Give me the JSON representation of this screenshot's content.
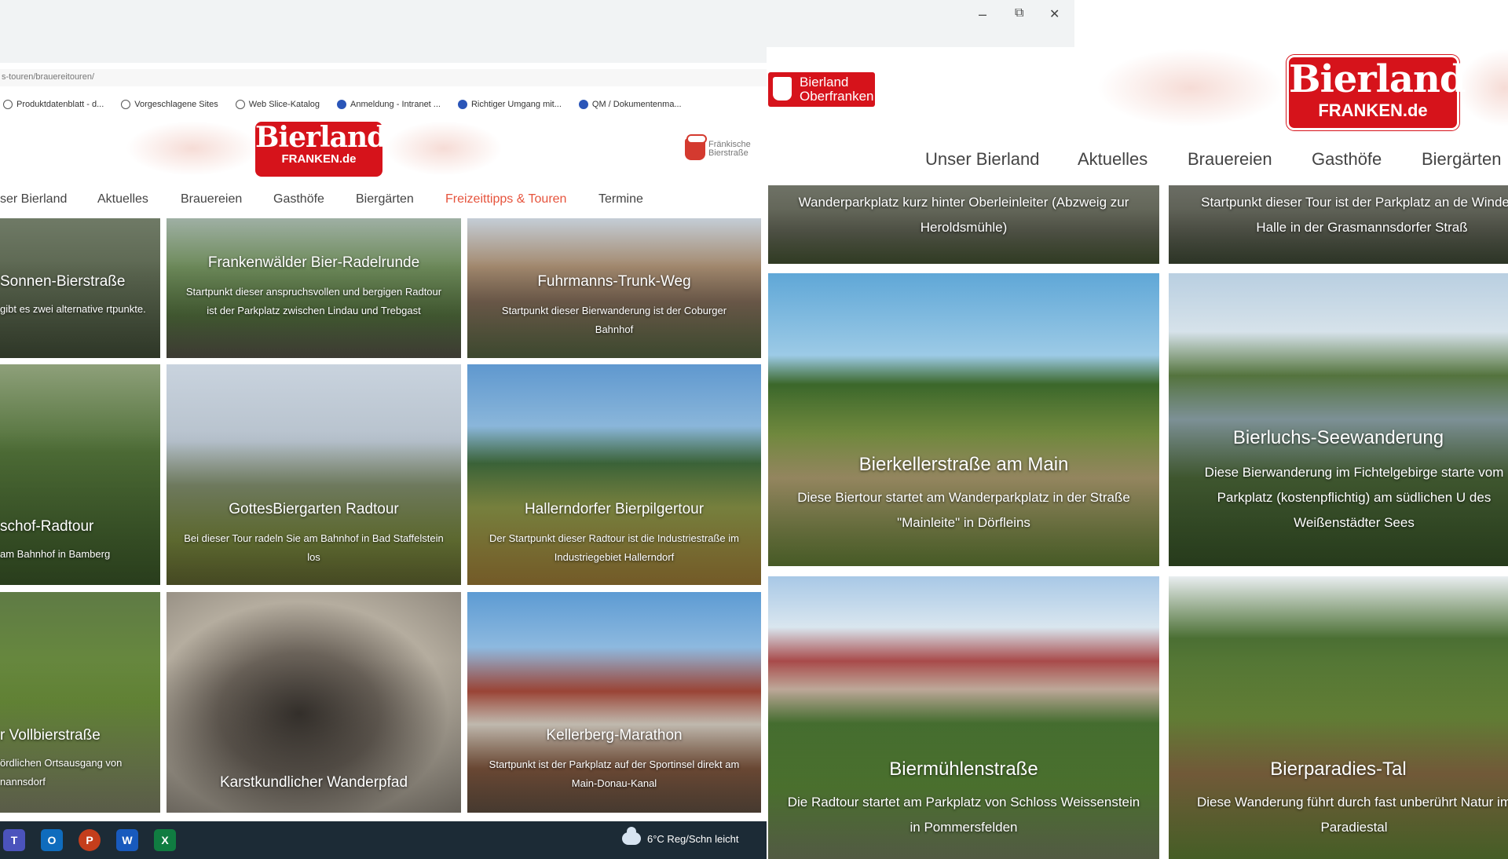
{
  "left_window": {
    "address_bar": {
      "url": "s-touren/brauereitouren/"
    },
    "bookmarks": [
      {
        "label": "Produktdatenblatt - d...",
        "icon": "globe-icon"
      },
      {
        "label": "Vorgeschlagene Sites",
        "icon": "globe-icon"
      },
      {
        "label": "Web Slice-Katalog",
        "icon": "globe-icon"
      },
      {
        "label": "Anmeldung - Intranet ...",
        "icon": "browser-icon"
      },
      {
        "label": "Richtiger Umgang mit...",
        "icon": "browser-icon"
      },
      {
        "label": "QM / Dokumentenma...",
        "icon": "browser-icon"
      }
    ],
    "logo": {
      "line1": "Bierland",
      "line2": "FRANKEN.de"
    },
    "franken_badge": {
      "line1": "Fränkische",
      "line2": "Bierstraße"
    },
    "nav": [
      {
        "label": "ser Bierland"
      },
      {
        "label": "Aktuelles"
      },
      {
        "label": "Brauereien"
      },
      {
        "label": "Gasthöfe"
      },
      {
        "label": "Biergärten"
      },
      {
        "label": "Freizeittipps & Touren"
      },
      {
        "label": "Termine"
      }
    ],
    "tiles": [
      {
        "title": "Sonnen-Bierstraße",
        "desc": "gibt es zwei alternative rtpunkte."
      },
      {
        "title": "Frankenwälder Bier-Radelrunde",
        "desc": "Startpunkt dieser anspruchsvollen und bergigen Radtour ist der Parkplatz zwischen Lindau und Trebgast"
      },
      {
        "title": "Fuhrmanns-Trunk-Weg",
        "desc": "Startpunkt dieser Bierwanderung ist der Coburger Bahnhof"
      },
      {
        "title": "schof-Radtour",
        "desc": "am Bahnhof in Bamberg"
      },
      {
        "title": "GottesBiergarten Radtour",
        "desc": "Bei dieser Tour radeln Sie am Bahnhof in Bad Staffelstein los"
      },
      {
        "title": "Hallerndorfer Bierpilgertour",
        "desc": "Der Startpunkt dieser Radtour ist die Industriestraße im Industriegebiet Hallerndorf"
      },
      {
        "title": "r Vollbierstraße",
        "desc": "ördlichen Ortsausgang von nannsdorf"
      },
      {
        "title": "Karstkundlicher Wanderpfad",
        "desc": ""
      },
      {
        "title": "Kellerberg-Marathon",
        "desc": "Startpunkt ist der Parkplatz auf der Sportinsel direkt am Main-Donau-Kanal"
      }
    ],
    "taskbar": {
      "apps": [
        "Teams",
        "Outlook",
        "PowerPoint",
        "Word",
        "Excel"
      ],
      "weather": "6°C  Reg/Schn leicht"
    }
  },
  "right_window": {
    "window_controls": {
      "minimize": "–",
      "restore": "⧉",
      "close": "✕"
    },
    "oberfranken_logo": {
      "line1": "Bierland",
      "line2": "Oberfranken"
    },
    "logo": {
      "line1": "Bierland",
      "line2": "FRANKEN.de"
    },
    "nav": [
      {
        "label": "Unser Bierland"
      },
      {
        "label": "Aktuelles"
      },
      {
        "label": "Brauereien"
      },
      {
        "label": "Gasthöfe"
      },
      {
        "label": "Biergärten"
      }
    ],
    "tiles": [
      {
        "title": "",
        "desc": "Wanderparkplatz kurz hinter Oberleinleiter (Abzweig zur Heroldsmühle)"
      },
      {
        "title": "",
        "desc": "Startpunkt dieser Tour ist der Parkplatz an de Windeck Halle in der Grasmannsdorfer Straß"
      },
      {
        "title": "Bierkellerstraße am Main",
        "desc": "Diese Biertour startet am Wanderparkplatz in der Straße \"Mainleite\" in Dörfleins"
      },
      {
        "title": "Bierluchs-Seewanderung",
        "desc": "Diese Bierwanderung im Fichtelgebirge starte vom Parkplatz (kostenpflichtig) am südlichen U des Weißenstädter Sees"
      },
      {
        "title": "Biermühlenstraße",
        "desc": "Die Radtour startet am Parkplatz von Schloss Weissenstein in Pommersfelden"
      },
      {
        "title": "Bierparadies-Tal",
        "desc": "Diese Wanderung führt durch fast unberührt Natur im Paradiestal"
      }
    ]
  },
  "colors": {
    "brand_red": "#d6131b",
    "nav_active": "#e6533c",
    "taskbar": "#1c2b36"
  }
}
